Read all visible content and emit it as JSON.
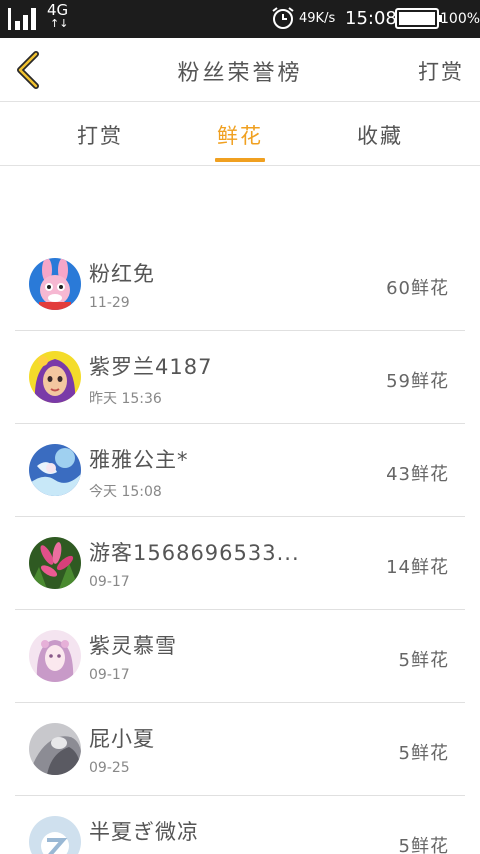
{
  "status_bar": {
    "signal_icon": "signal-bars-icon",
    "network_type": "4G",
    "network_arrows": "↑↓",
    "alarm_icon": "alarm-clock-icon",
    "speed": "49K/s",
    "time": "15:08",
    "battery_icon": "battery-icon",
    "battery_level": 1.0,
    "battery_pct": "100%"
  },
  "header": {
    "back_icon": "chevron-left-icon",
    "title": "粉丝荣誉榜",
    "right_action": "打赏"
  },
  "tabs": [
    {
      "label": "打赏"
    },
    {
      "label": "鲜花"
    },
    {
      "label": "收藏"
    }
  ],
  "active_tab": "鲜花",
  "colors": {
    "accent": "#f0a020",
    "text": "#555555",
    "divider": "#e0e0e0",
    "status_bar": "#1c1c1c"
  },
  "fans": [
    {
      "name": "粉红免",
      "date": "11-29",
      "count": "60鲜花"
    },
    {
      "name": "紫罗兰4187",
      "date": "昨天 15:36",
      "count": "59鲜花"
    },
    {
      "name": "雅雅公主*",
      "date": "今天 15:08",
      "count": "43鲜花"
    },
    {
      "name": "游客1568696533...",
      "date": "09-17",
      "count": "14鲜花"
    },
    {
      "name": "紫灵慕雪",
      "date": "09-17",
      "count": "5鲜花"
    },
    {
      "name": "屁小夏",
      "date": "09-25",
      "count": "5鲜花"
    },
    {
      "name": "半夏ぎ微凉",
      "date": "",
      "count": "5鲜花"
    }
  ]
}
